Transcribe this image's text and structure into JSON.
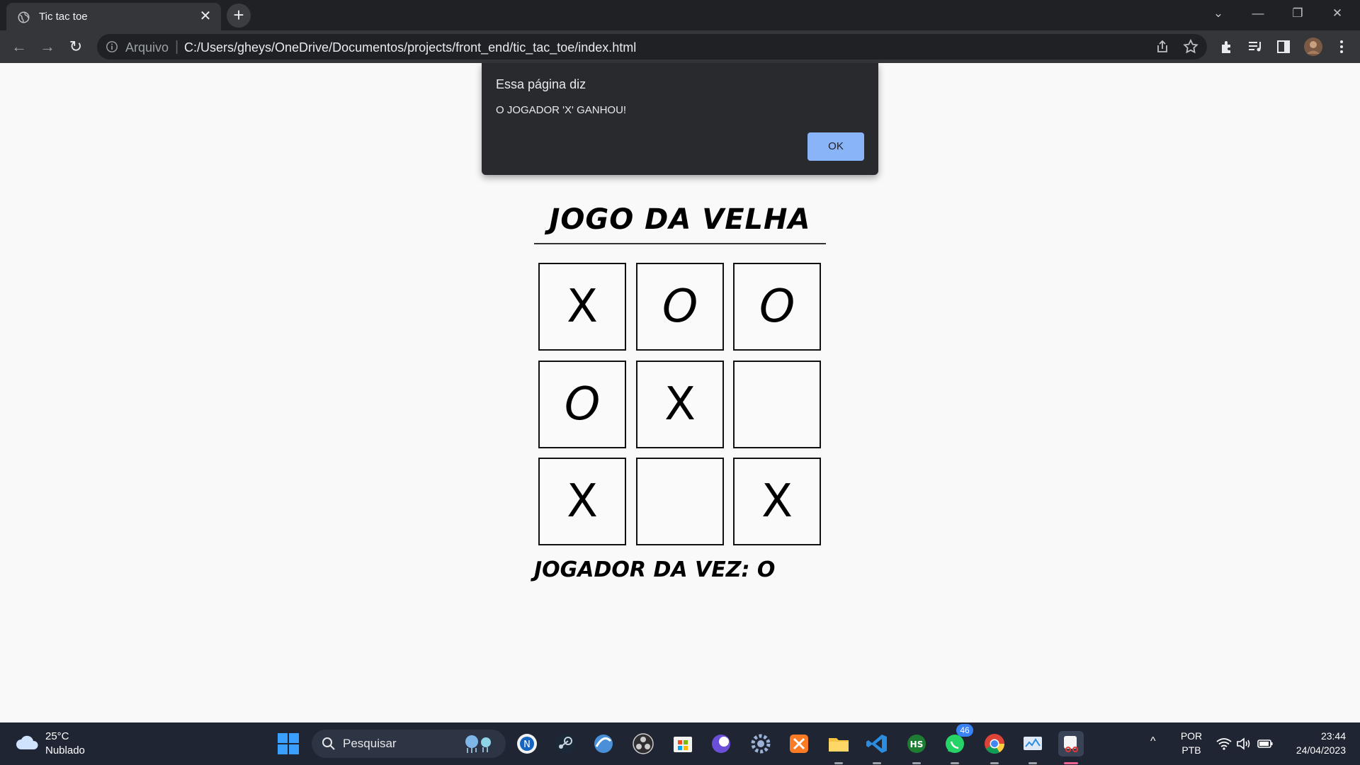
{
  "browser": {
    "tab_title": "Tic tac toe",
    "tab_close": "✕",
    "new_tab": "+",
    "url_scheme": "Arquivo",
    "url_separator": "|",
    "url": "C:/Users/gheys/OneDrive/Documentos/projects/front_end/tic_tac_toe/index.html",
    "window_controls": {
      "tab_search": "⌄",
      "minimize": "—",
      "restore": "❐",
      "close": "✕"
    },
    "nav": {
      "back": "←",
      "forward": "→",
      "reload": "↻"
    }
  },
  "dialog": {
    "title": "Essa página diz",
    "message": "O JOGADOR 'X' GANHOU!",
    "ok_label": "OK"
  },
  "game": {
    "title": "JOGO DA VELHA",
    "board": [
      "X",
      "O",
      "O",
      "O",
      "X",
      "",
      "X",
      "",
      "X"
    ],
    "turn_text": "JOGADOR DA VEZ: O"
  },
  "taskbar": {
    "weather_temp": "25°C",
    "weather_desc": "Nublado",
    "search_placeholder": "Pesquisar",
    "whatsapp_badge": "46",
    "tray_chevron": "^",
    "lang_line1": "POR",
    "lang_line2": "PTB",
    "time": "23:44",
    "date": "24/04/2023"
  },
  "colors": {
    "chrome_dark": "#202124",
    "toolbar": "#35363a",
    "dialog_bg": "#292a2d",
    "ok_button": "#8ab4f8",
    "page_bg": "#f9f9f9",
    "taskbar": "#1f2532"
  }
}
